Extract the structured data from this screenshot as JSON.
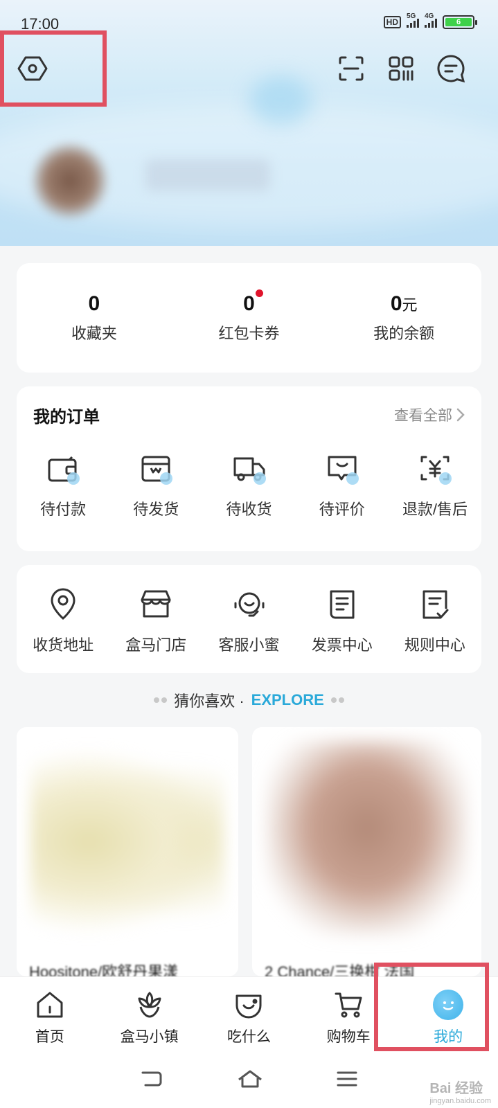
{
  "status_bar": {
    "time": "17:00",
    "network1": "5G",
    "network2": "4G",
    "battery": "6",
    "hd": "HD"
  },
  "stats": [
    {
      "value": "0",
      "unit": "",
      "label": "收藏夹",
      "badge": false
    },
    {
      "value": "0",
      "unit": "",
      "label": "红包卡券",
      "badge": true
    },
    {
      "value": "0",
      "unit": "元",
      "label": "我的余额",
      "badge": false
    }
  ],
  "orders": {
    "title": "我的订单",
    "view_all": "查看全部",
    "items": [
      {
        "label": "待付款",
        "icon": "wallet-icon"
      },
      {
        "label": "待发货",
        "icon": "box-icon"
      },
      {
        "label": "待收货",
        "icon": "truck-icon"
      },
      {
        "label": "待评价",
        "icon": "review-icon"
      },
      {
        "label": "退款/售后",
        "icon": "refund-icon"
      }
    ]
  },
  "services": [
    {
      "label": "收货地址",
      "icon": "location-icon"
    },
    {
      "label": "盒马门店",
      "icon": "store-icon"
    },
    {
      "label": "客服小蜜",
      "icon": "headset-icon"
    },
    {
      "label": "发票中心",
      "icon": "invoice-icon"
    },
    {
      "label": "规则中心",
      "icon": "rules-icon"
    }
  ],
  "explore": {
    "text": "猜你喜欢 ·",
    "en": "EXPLORE"
  },
  "products": [
    {
      "title": "Hoositone/欧舒丹果漾"
    },
    {
      "title": "2 Chance/三换柑 法国"
    }
  ],
  "tabs": [
    {
      "label": "首页",
      "icon": "home-icon",
      "active": false
    },
    {
      "label": "盒马小镇",
      "icon": "flower-icon",
      "active": false
    },
    {
      "label": "吃什么",
      "icon": "food-icon",
      "active": false
    },
    {
      "label": "购物车",
      "icon": "cart-icon",
      "active": false
    },
    {
      "label": "我的",
      "icon": "me-icon",
      "active": true
    }
  ],
  "watermark": {
    "main": "Bai 经验",
    "sub": "jingyan.baidu.com"
  },
  "colors": {
    "accent": "#2aa9d9",
    "highlight": "#e05060",
    "badge": "#e0142b"
  }
}
